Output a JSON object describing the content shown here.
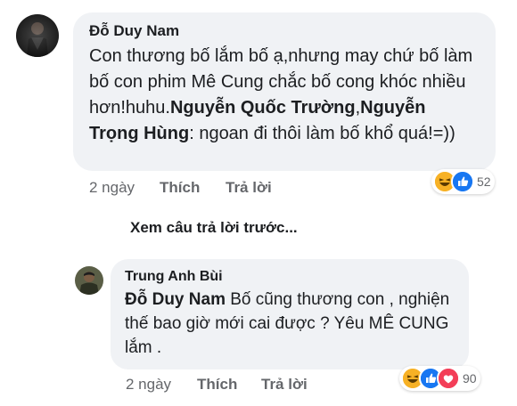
{
  "comment1": {
    "author": "Đỗ Duy Nam",
    "text_before": "Con thương bố lắm bố ạ,nhưng may chứ bố làm bố con phim Mê Cung chắc bố cong khóc nhiều hơn!huhu.",
    "mention1": "Nguyễn Quốc Trường",
    "separator": ",",
    "mention2": "Nguyễn Trọng Hùng",
    "text_after": ": ngoan đi thôi làm bố khổ quá!=))",
    "time": "2 ngày",
    "like_label": "Thích",
    "reply_label": "Trả lời",
    "reactions": [
      "haha-icon",
      "like-icon"
    ],
    "reaction_count": "52"
  },
  "view_previous": "Xem câu trả lời trước...",
  "comment2": {
    "author": "Trung Anh Bùi",
    "mention": "Đỗ Duy Nam",
    "text": " Bố cũng thương con , nghiện thế bao giờ mới cai được ? Yêu MÊ CUNG lắm .",
    "time": "2 ngày",
    "like_label": "Thích",
    "reply_label": "Trả lời",
    "reactions": [
      "haha-icon",
      "like-icon",
      "love-icon"
    ],
    "reaction_count": "90"
  },
  "colors": {
    "bubble": "#f0f2f5",
    "text": "#1c1e21",
    "meta": "#65676b",
    "like_blue": "#1877f2",
    "love_red": "#f33e58",
    "haha_yellow": "#f7b125"
  }
}
